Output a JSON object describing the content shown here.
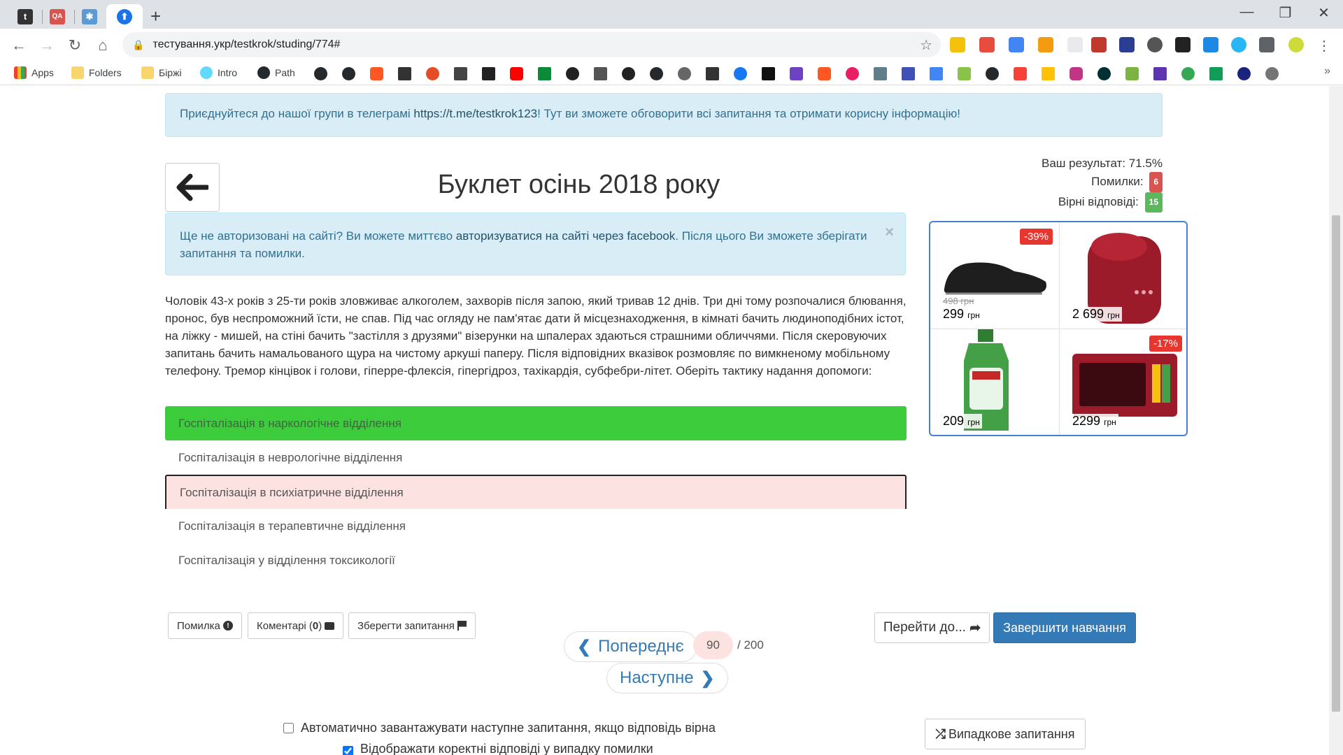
{
  "browser": {
    "tabs": [
      {
        "icon": "t",
        "color": "#333333"
      },
      {
        "icon": "QA",
        "color": "#d9534f"
      },
      {
        "icon": "✱",
        "color": "#5b9bd5"
      },
      {
        "icon": "⬆",
        "color": "#1a73e8",
        "active": true
      }
    ],
    "url": "тестування.укр/testkrok/studing/774#",
    "bookmarks": [
      {
        "label": "Apps"
      },
      {
        "label": "Folders"
      },
      {
        "label": "Біржі"
      },
      {
        "label": "Intro"
      },
      {
        "label": "Path"
      }
    ]
  },
  "banner": {
    "text_before": "Приєднуйтеся до нашої групи в телеграмі ",
    "link": "https://t.me/testkrok123",
    "text_after": "! Тут ви зможете обговорити всі запитання та отримати корисну інформацію!"
  },
  "title": "Буклет осінь 2018 року",
  "result": {
    "score_label": "Ваш результат: 71.5%",
    "errors_label": "Помилки:",
    "errors_count": "6",
    "correct_label": "Вірні відповіді:",
    "correct_count": "15"
  },
  "login_alert": {
    "text_before": "Ще не авторизовані на сайті? Ви можете миттєво ",
    "link": "авторизуватися на сайті через facebook",
    "text_after": ". Після цього Ви зможете зберігати запитання та помилки.",
    "close": "×"
  },
  "question": "Чоловік 43-х років з 25-ти років зловживає алкоголем, захворів після запою, який тривав 12 днів. Три дні тому розпочалися блювання, пронос, був неспроможний їсти, не спав. Під час огляду не пам'ятає дати й місцезнаходження, в кімнаті бачить людиноподібних істот, на ліжку - мишей, на стіні бачить \"застілля з друзями\" візерунки на шпалерах здаються страшними обличчями. Після скеровуючих запитань бачить намальованого щура на чистому аркуші паперу. Після відповідних вказівок розмовляє по вимкненому мобільному телефону. Тремор кінцівок і голови, гіперре-флексія, гіпергідроз, тахікардія, субфебри-літет. Оберіть тактику надання допомоги:",
  "answers": [
    {
      "text": "Госпіталізація в наркологічне відділення",
      "state": "correct"
    },
    {
      "text": "Госпіталізація в неврологічне відділення",
      "state": "neutral"
    },
    {
      "text": "Госпіталізація в психіатричне відділення",
      "state": "wrong"
    },
    {
      "text": "Госпіталізація в терапевтичне відділення",
      "state": "neutral"
    },
    {
      "text": "Госпіталізація у відділення токсикології",
      "state": "neutral"
    }
  ],
  "actions": {
    "error_label": "Помилка",
    "comments_label": "Коментарі (",
    "comments_count": "0",
    "comments_close": ")",
    "save_label": "Зберегти запитання"
  },
  "pager": {
    "prev_label": "Попереднє",
    "next_label": "Наступне",
    "current": "90",
    "total": "/ 200"
  },
  "goto_label": "Перейти до...",
  "finish_label": "Завершити навчання",
  "options": {
    "auto_load_label": "Автоматично завантажувати наступне запитання, якщо відповідь вірна",
    "auto_load_checked": false,
    "show_correct_label": "Відображати коректні відповіді у випадку помилки",
    "show_correct_checked": true
  },
  "random_label": "Випадкове запитання",
  "ads": [
    {
      "price": "299",
      "currency": "грн",
      "old_price": "498 грн",
      "discount": "-39%",
      "item": "slippers"
    },
    {
      "price": "2 699",
      "currency": "грн",
      "old_price": "",
      "discount": "",
      "item": "earbuds"
    },
    {
      "price": "209",
      "currency": "грн",
      "old_price": "",
      "discount": "",
      "item": "detergent"
    },
    {
      "price": "2299",
      "currency": "грн",
      "old_price": "",
      "discount": "-17%",
      "item": "oven"
    }
  ]
}
